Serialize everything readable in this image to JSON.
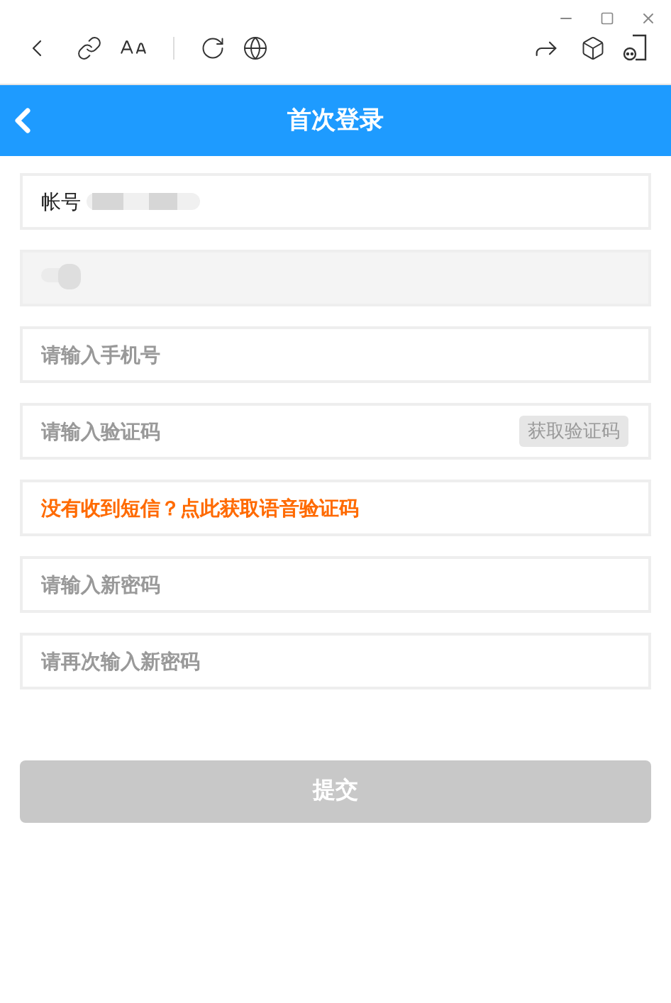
{
  "header": {
    "title": "首次登录"
  },
  "fields": [
    {
      "kind": "account",
      "label": "帐号",
      "redacted": true
    },
    {
      "kind": "disabled",
      "redacted": true
    },
    {
      "kind": "input",
      "placeholder": "请输入手机号"
    },
    {
      "kind": "code",
      "placeholder": "请输入验证码",
      "button": "获取验证码"
    },
    {
      "kind": "link",
      "text": "没有收到短信？点此获取语音验证码"
    },
    {
      "kind": "input",
      "placeholder": "请输入新密码"
    },
    {
      "kind": "input",
      "placeholder": "请再次输入新密码"
    }
  ],
  "submit": {
    "label": "提交",
    "disabled": true
  }
}
